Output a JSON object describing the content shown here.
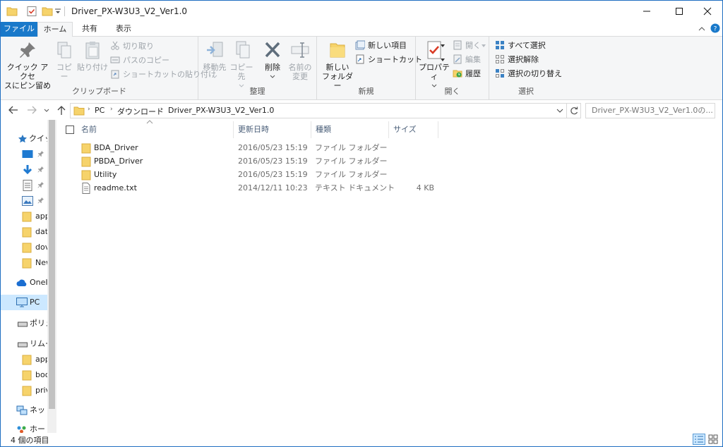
{
  "window": {
    "title": "Driver_PX-W3U3_V2_Ver1.0"
  },
  "tabs": {
    "file": "ファイル",
    "home": "ホーム",
    "share": "共有",
    "view": "表示"
  },
  "ribbon": {
    "clipboard": {
      "group_label": "クリップボード",
      "pin_line1": "クイック アクセ",
      "pin_line2": "スにピン留め",
      "copy": "コピー",
      "paste": "貼り付け",
      "cut": "切り取り",
      "copy_path": "パスのコピー",
      "paste_shortcut": "ショートカットの貼り付け"
    },
    "organize": {
      "group_label": "整理",
      "move_to": "移動先",
      "copy_to": "コピー先",
      "delete": "削除",
      "rename_line1": "名前の",
      "rename_line2": "変更"
    },
    "new": {
      "group_label": "新規",
      "new_folder_line1": "新しい",
      "new_folder_line2": "フォルダー",
      "new_item": "新しい項目",
      "shortcut": "ショートカット"
    },
    "open": {
      "group_label": "開く",
      "properties": "プロパティ",
      "open": "開く",
      "edit": "編集",
      "history": "履歴"
    },
    "select": {
      "group_label": "選択",
      "select_all": "すべて選択",
      "select_none": "選択解除",
      "invert": "選択の切り替え"
    }
  },
  "address": {
    "crumbs": [
      "PC",
      "ダウンロード",
      "Driver_PX-W3U3_V2_Ver1.0"
    ],
    "search_placeholder": "Driver_PX-W3U3_V2_Ver1.0の..."
  },
  "navpane": {
    "quick_access": "クイッ",
    "folders": [
      "app",
      "dat",
      "dov",
      "New"
    ],
    "onedrive": "OneI",
    "pc": "PC",
    "portable": "ポリュ",
    "removable": "リムー",
    "removable_folders": [
      "app",
      "boo",
      "priv"
    ],
    "network": "ネット",
    "homegroup": "ホー"
  },
  "filelist": {
    "headers": {
      "name": "名前",
      "date": "更新日時",
      "type": "種類",
      "size": "サイズ"
    },
    "rows": [
      {
        "name": "BDA_Driver",
        "date": "2016/05/23 15:19",
        "type": "ファイル フォルダー",
        "size": "",
        "kind": "folder"
      },
      {
        "name": "PBDA_Driver",
        "date": "2016/05/23 15:19",
        "type": "ファイル フォルダー",
        "size": "",
        "kind": "folder"
      },
      {
        "name": "Utility",
        "date": "2016/05/23 15:19",
        "type": "ファイル フォルダー",
        "size": "",
        "kind": "folder"
      },
      {
        "name": "readme.txt",
        "date": "2014/12/11 10:23",
        "type": "テキスト ドキュメント",
        "size": "4 KB",
        "kind": "text"
      }
    ]
  },
  "status": {
    "count": "4 個の項目"
  },
  "colors": {
    "accent": "#1979ca",
    "folder": "#f6d36b",
    "selection": "#cce8ff"
  }
}
